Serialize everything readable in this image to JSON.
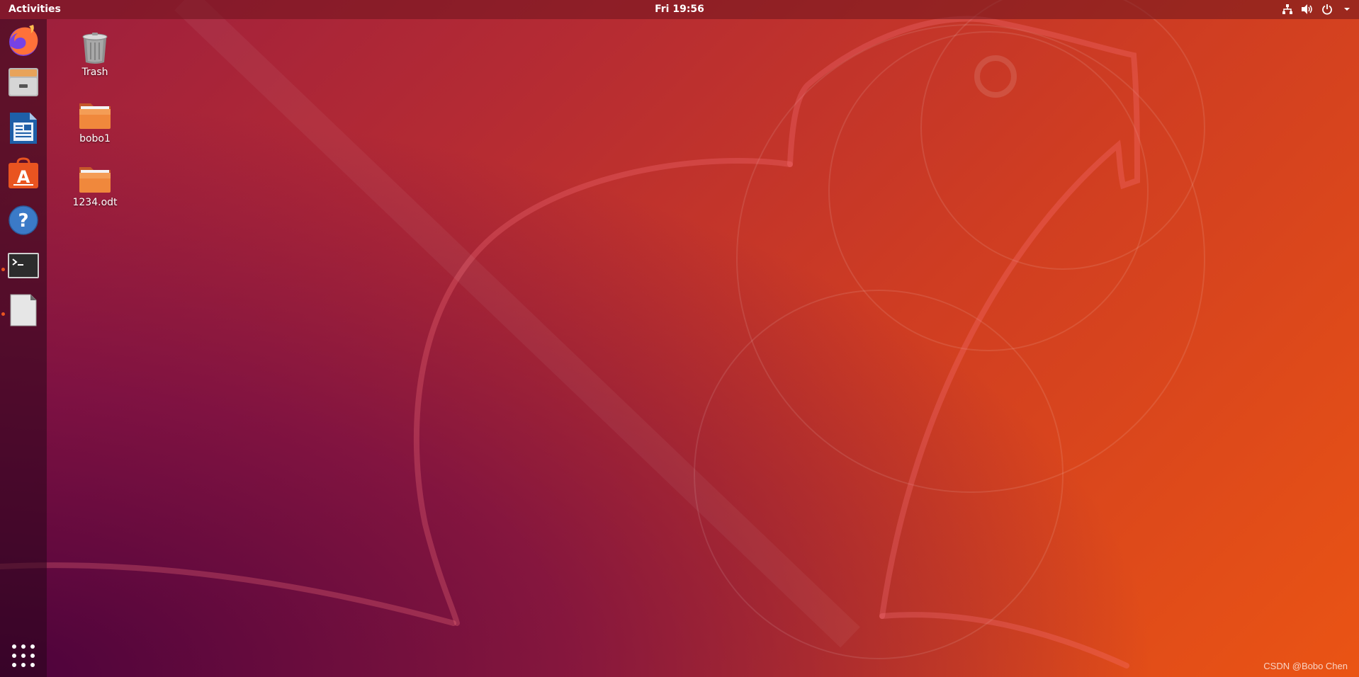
{
  "topbar": {
    "activities_label": "Activities",
    "clock": "Fri 19:56",
    "tray_icons": [
      "network-icon",
      "volume-icon",
      "power-icon",
      "chevron-down-icon"
    ]
  },
  "dock": {
    "items": [
      {
        "name": "firefox-icon",
        "running": false
      },
      {
        "name": "files-icon",
        "running": false
      },
      {
        "name": "libreoffice-writer-icon",
        "running": false
      },
      {
        "name": "ubuntu-software-icon",
        "running": false
      },
      {
        "name": "help-icon",
        "running": false
      },
      {
        "name": "terminal-icon",
        "running": true
      },
      {
        "name": "text-document-icon",
        "running": true
      }
    ],
    "show_applications_icon": "app-grid-icon"
  },
  "desktop": {
    "icons": [
      {
        "label": "Trash",
        "icon": "trash-icon"
      },
      {
        "label": "bobo1",
        "icon": "folder-icon"
      },
      {
        "label": "1234.odt",
        "icon": "folder-icon"
      }
    ]
  },
  "watermark": "CSDN @Bobo Chen",
  "colors": {
    "accent": "#e95420",
    "folder": "#f08a3c",
    "topbar_text": "#ffffff"
  }
}
